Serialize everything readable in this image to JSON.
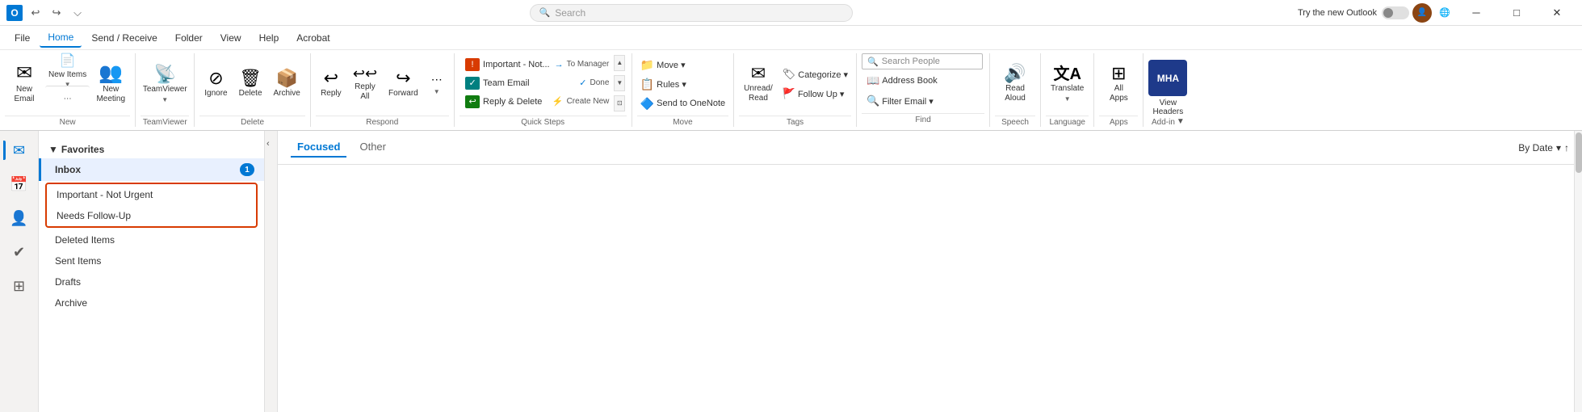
{
  "titlebar": {
    "app_name": "Outlook",
    "search_placeholder": "Search",
    "try_new_label": "Try the new Outlook",
    "toggle_state": "off",
    "win_btns": {
      "minimize": "─",
      "maximize": "□",
      "close": "✕"
    }
  },
  "menubar": {
    "items": [
      {
        "id": "file",
        "label": "File"
      },
      {
        "id": "home",
        "label": "Home",
        "active": true
      },
      {
        "id": "send-receive",
        "label": "Send / Receive"
      },
      {
        "id": "folder",
        "label": "Folder"
      },
      {
        "id": "view",
        "label": "View"
      },
      {
        "id": "help",
        "label": "Help"
      },
      {
        "id": "acrobat",
        "label": "Acrobat"
      }
    ]
  },
  "ribbon": {
    "groups": [
      {
        "id": "new",
        "label": "New",
        "buttons": [
          {
            "id": "new-email",
            "icon": "✉",
            "label": "New\nEmail",
            "has_dropdown": false
          },
          {
            "id": "new-items",
            "icon": "📄",
            "label": "New\nItems",
            "has_dropdown": true
          },
          {
            "id": "new-meeting",
            "icon": "👥",
            "label": "New\nMeeting",
            "has_dropdown": false
          }
        ]
      },
      {
        "id": "teamviewer",
        "label": "TeamViewer",
        "buttons": [
          {
            "id": "teamviewer-btn",
            "icon": "📡",
            "label": "TeamViewer",
            "has_dropdown": true
          }
        ]
      },
      {
        "id": "delete",
        "label": "Delete",
        "buttons": [
          {
            "id": "ignore",
            "icon": "⊘",
            "label": "Ignore",
            "has_dropdown": false
          },
          {
            "id": "delete",
            "icon": "🗑",
            "label": "Delete",
            "has_dropdown": false
          },
          {
            "id": "archive",
            "icon": "📦",
            "label": "Archive",
            "has_dropdown": false
          }
        ]
      },
      {
        "id": "respond",
        "label": "Respond",
        "buttons": [
          {
            "id": "reply",
            "icon": "↩",
            "label": "Reply",
            "has_dropdown": false
          },
          {
            "id": "reply-all",
            "icon": "↩↩",
            "label": "Reply\nAll",
            "has_dropdown": false
          },
          {
            "id": "forward",
            "icon": "→",
            "label": "Forward",
            "has_dropdown": false
          },
          {
            "id": "more-respond",
            "icon": "⋯",
            "label": "More",
            "has_dropdown": true
          }
        ]
      },
      {
        "id": "quick-steps",
        "label": "Quick Steps",
        "items": [
          {
            "id": "important-not-urgent",
            "label": "Important - Not...",
            "icon": "!",
            "color": "red",
            "arrow": "→",
            "arrow_label": "To Manager"
          },
          {
            "id": "team-email",
            "label": "Team Email",
            "icon": "✓",
            "color": "teal",
            "arrow": "✓",
            "arrow_label": "Done"
          },
          {
            "id": "reply-delete",
            "label": "Reply & Delete",
            "icon": "↩",
            "color": "green",
            "arrow": "⚡",
            "arrow_label": "Create New"
          }
        ]
      },
      {
        "id": "move",
        "label": "Move",
        "buttons": [
          {
            "id": "move-btn",
            "icon": "📁",
            "label": "Move",
            "has_dropdown": true
          },
          {
            "id": "rules-btn",
            "icon": "📋",
            "label": "Rules",
            "has_dropdown": true
          },
          {
            "id": "send-to-onenote",
            "icon": "🔷",
            "label": "Send to OneNote",
            "has_dropdown": false
          }
        ]
      },
      {
        "id": "tags",
        "label": "Tags",
        "buttons": [
          {
            "id": "unread-read",
            "icon": "✉",
            "label": "Unread/\nRead",
            "has_dropdown": false
          },
          {
            "id": "categorize",
            "icon": "🏷",
            "label": "Categorize",
            "has_dropdown": true
          },
          {
            "id": "follow-up",
            "icon": "🚩",
            "label": "Follow Up",
            "has_dropdown": true
          }
        ]
      },
      {
        "id": "find",
        "label": "Find",
        "search_placeholder": "Search People",
        "buttons": [
          {
            "id": "address-book",
            "icon": "📖",
            "label": "Address Book",
            "has_dropdown": false
          },
          {
            "id": "filter-email",
            "icon": "🔍",
            "label": "Filter Email",
            "has_dropdown": true
          }
        ]
      },
      {
        "id": "speech",
        "label": "Speech",
        "buttons": [
          {
            "id": "read-aloud",
            "icon": "🔊",
            "label": "Read\nAloud",
            "has_dropdown": false
          }
        ]
      },
      {
        "id": "language",
        "label": "Language",
        "buttons": [
          {
            "id": "translate",
            "icon": "文A",
            "label": "Translate",
            "has_dropdown": true
          }
        ]
      },
      {
        "id": "apps",
        "label": "Apps",
        "buttons": [
          {
            "id": "all-apps",
            "icon": "⊞",
            "label": "All\nApps",
            "has_dropdown": false
          }
        ]
      },
      {
        "id": "add-in",
        "label": "Add-in",
        "buttons": [
          {
            "id": "view-headers",
            "icon": "MHA",
            "label": "View\nHeaders",
            "is_mha": true
          }
        ]
      }
    ]
  },
  "sidebar": {
    "items": [
      {
        "id": "mail",
        "icon": "✉",
        "label": "Mail",
        "active": true,
        "badge": null
      },
      {
        "id": "calendar",
        "icon": "📅",
        "label": "Calendar",
        "active": false,
        "badge": null
      },
      {
        "id": "people",
        "icon": "👤",
        "label": "People",
        "active": false,
        "badge": null
      },
      {
        "id": "tasks",
        "icon": "✔",
        "label": "Tasks",
        "active": false,
        "badge": null
      },
      {
        "id": "apps-nav",
        "icon": "⊞",
        "label": "Apps",
        "active": false,
        "badge": null
      }
    ]
  },
  "folder_panel": {
    "favorites_label": "Favorites",
    "folders": [
      {
        "id": "inbox",
        "label": "Inbox",
        "badge": "1",
        "selected": true
      },
      {
        "id": "important-not-urgent",
        "label": "Important - Not Urgent",
        "badge": null,
        "highlighted": true
      },
      {
        "id": "needs-follow-up",
        "label": "Needs Follow-Up",
        "badge": null,
        "highlighted": true
      },
      {
        "id": "deleted-items",
        "label": "Deleted Items",
        "badge": null,
        "selected": false
      },
      {
        "id": "sent-items",
        "label": "Sent Items",
        "badge": null,
        "selected": false
      },
      {
        "id": "drafts",
        "label": "Drafts",
        "badge": null,
        "selected": false
      },
      {
        "id": "archive-folder",
        "label": "Archive",
        "badge": null,
        "selected": false
      }
    ]
  },
  "email_list": {
    "tabs": [
      {
        "id": "focused",
        "label": "Focused",
        "active": true
      },
      {
        "id": "other",
        "label": "Other",
        "active": false
      }
    ],
    "sort_label": "By Date",
    "sort_direction": "desc"
  }
}
